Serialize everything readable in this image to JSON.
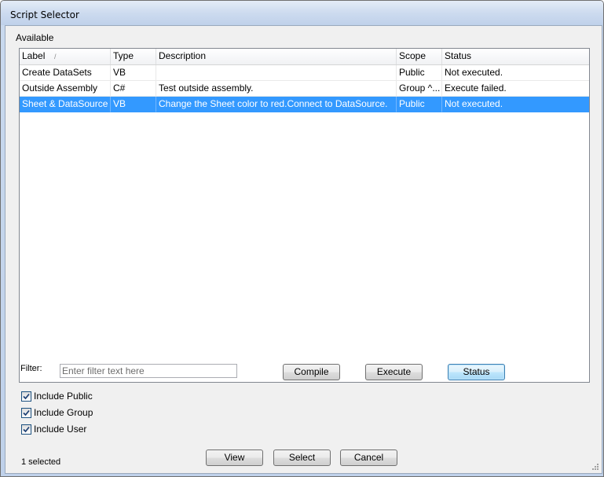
{
  "window": {
    "title": "Script Selector"
  },
  "available_label": "Available",
  "grid": {
    "columns": [
      "Label",
      "Type",
      "Description",
      "Scope",
      "Status"
    ],
    "sort_indicator": "/",
    "rows": [
      {
        "label": "Create DataSets",
        "type": "VB",
        "description": "",
        "scope": "Public",
        "status": "Not executed.",
        "selected": false
      },
      {
        "label": "Outside Assembly",
        "type": "C#",
        "description": "Test outside assembly.",
        "scope": "Group ^...",
        "status": "Execute failed.",
        "selected": false
      },
      {
        "label": "Sheet & DataSource",
        "type": "VB",
        "description": "Change the Sheet color to red.Connect to DataSource.",
        "scope": "Public",
        "status": "Not executed.",
        "selected": true
      }
    ]
  },
  "filter": {
    "label": "Filter:",
    "placeholder": "Enter filter text here",
    "value": ""
  },
  "buttons": {
    "compile": "Compile",
    "execute": "Execute",
    "status": "Status",
    "view": "View",
    "select": "Select",
    "cancel": "Cancel"
  },
  "checkboxes": [
    {
      "label": "Include Public",
      "checked": true
    },
    {
      "label": "Include Group",
      "checked": true
    },
    {
      "label": "Include User",
      "checked": true
    }
  ],
  "selection_count": "1 selected",
  "icons": {
    "checkmark": "checkmark-icon",
    "grip": "resize-grip-icon"
  }
}
